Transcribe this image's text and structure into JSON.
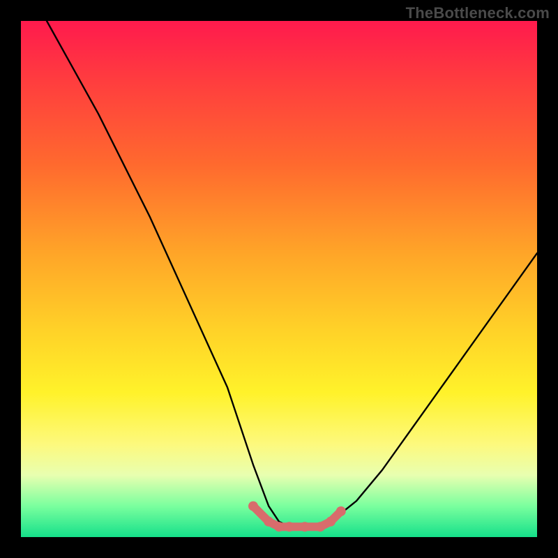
{
  "watermark": "TheBottleneck.com",
  "colors": {
    "frame": "#000000",
    "accent": "#d86c6c",
    "curve": "#000000"
  },
  "chart_data": {
    "type": "line",
    "title": "",
    "xlabel": "",
    "ylabel": "",
    "xlim": [
      0,
      100
    ],
    "ylim": [
      0,
      100
    ],
    "grid": false,
    "legend": false,
    "note": "Axis values are in percent of plot area; curve depicts bottleneck severity (high = red top, low = green bottom) vs. an unlabeled x.",
    "series": [
      {
        "name": "bottleneck-curve",
        "x": [
          5,
          10,
          15,
          20,
          25,
          30,
          35,
          40,
          45,
          48,
          50,
          52,
          55,
          58,
          60,
          65,
          70,
          75,
          80,
          85,
          90,
          95,
          100
        ],
        "y": [
          100,
          91,
          82,
          72,
          62,
          51,
          40,
          29,
          14,
          6,
          3,
          2,
          2,
          2,
          3,
          7,
          13,
          20,
          27,
          34,
          41,
          48,
          55
        ]
      }
    ],
    "highlight": {
      "name": "valley-accent",
      "x": [
        45,
        48,
        50,
        52,
        55,
        58,
        60,
        62
      ],
      "y": [
        6,
        3,
        2,
        2,
        2,
        2,
        3,
        5
      ]
    }
  }
}
